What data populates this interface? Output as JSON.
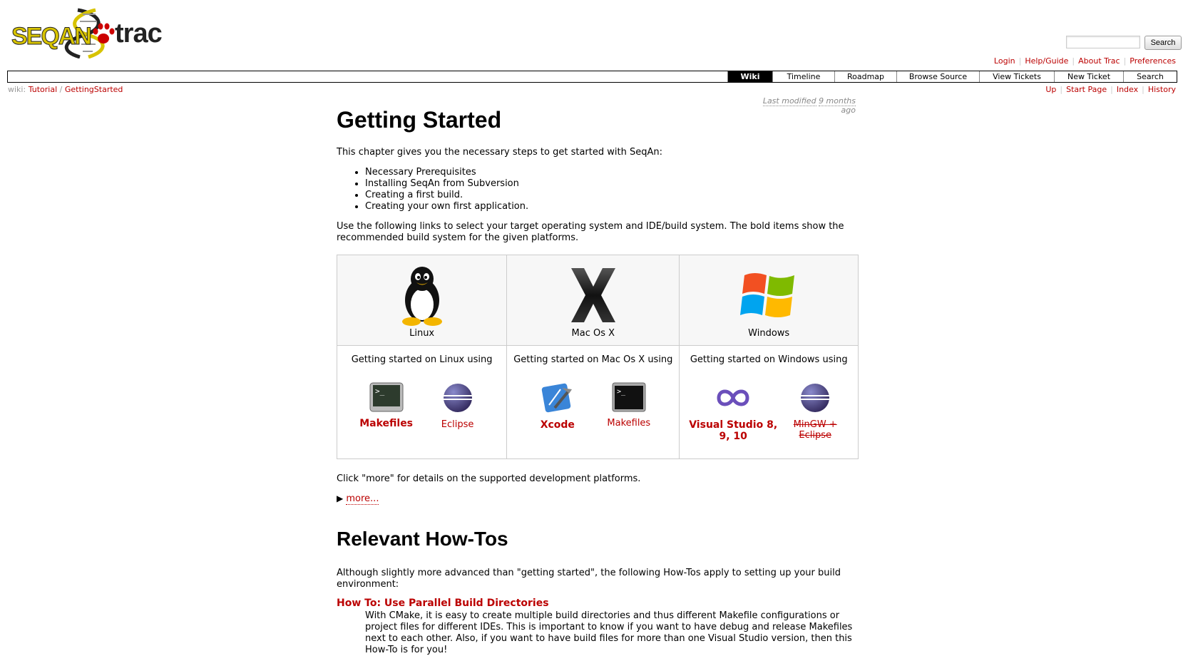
{
  "header": {
    "logo": {
      "seq_text": "SEQAN",
      "trac_text": "trac"
    },
    "search_button": "Search",
    "metanav": [
      "Login",
      "Help/Guide",
      "About Trac",
      "Preferences"
    ]
  },
  "mainnav": [
    {
      "label": "Wiki",
      "active": true
    },
    {
      "label": "Timeline"
    },
    {
      "label": "Roadmap"
    },
    {
      "label": "Browse Source"
    },
    {
      "label": "View Tickets"
    },
    {
      "label": "New Ticket"
    },
    {
      "label": "Search"
    }
  ],
  "breadcrumb": {
    "prefix": "wiki:",
    "part1": "Tutorial",
    "sep": "/",
    "part2": "GettingStarted"
  },
  "ctxnav": [
    "Up",
    "Start Page",
    "Index",
    "History"
  ],
  "last_modified": {
    "prefix": "Last modified",
    "age": "9 months",
    "suffix": "ago"
  },
  "page": {
    "title": "Getting Started",
    "intro": "This chapter gives you the necessary steps to get started with SeqAn:",
    "bullets": [
      "Necessary Prerequisites",
      "Installing SeqAn from Subversion",
      "Creating a first build.",
      "Creating your own first application."
    ],
    "links_text": "Use the following links to select your target operating system and IDE/build system. The bold items show the recommended build system for the given platforms.",
    "platforms": [
      {
        "os": "Linux",
        "icon": "linux-penguin-icon",
        "heading": "Getting started on Linux using",
        "tools": [
          {
            "label": "Makefiles",
            "icon": "terminal-icon",
            "style": "bold"
          },
          {
            "label": "Eclipse",
            "icon": "eclipse-icon",
            "style": "normal"
          }
        ]
      },
      {
        "os": "Mac Os X",
        "icon": "mac-os-x-icon",
        "heading": "Getting started on Mac Os X using",
        "tools": [
          {
            "label": "Xcode",
            "icon": "xcode-icon",
            "style": "bold"
          },
          {
            "label": "Makefiles",
            "icon": "terminal-icon",
            "style": "normal"
          }
        ]
      },
      {
        "os": "Windows",
        "icon": "windows-flag-icon",
        "heading": "Getting started on Windows using",
        "tools": [
          {
            "label": "Visual Studio 8, 9, 10",
            "icon": "visual-studio-icon",
            "style": "bold"
          },
          {
            "label": "MinGW + Eclipse",
            "icon": "eclipse-icon",
            "style": "strike"
          }
        ]
      }
    ],
    "more_intro": "Click \"more\" for details on the supported development platforms.",
    "more_link": "more...",
    "howtos_title": "Relevant How-Tos",
    "howtos_intro": "Although slightly more advanced than \"getting started\", the following How-Tos apply to setting up your build environment:",
    "howto1_title": "How To: Use Parallel Build Directories",
    "howto1_text": "With CMake, it is easy to create multiple build directories and thus different Makefile configurations or project files for different IDEs. This is important to know if you want to have debug and release Makefiles next to each other. Also, if you want to have build files for more than one Visual Studio version, then this How-To is for you!"
  }
}
